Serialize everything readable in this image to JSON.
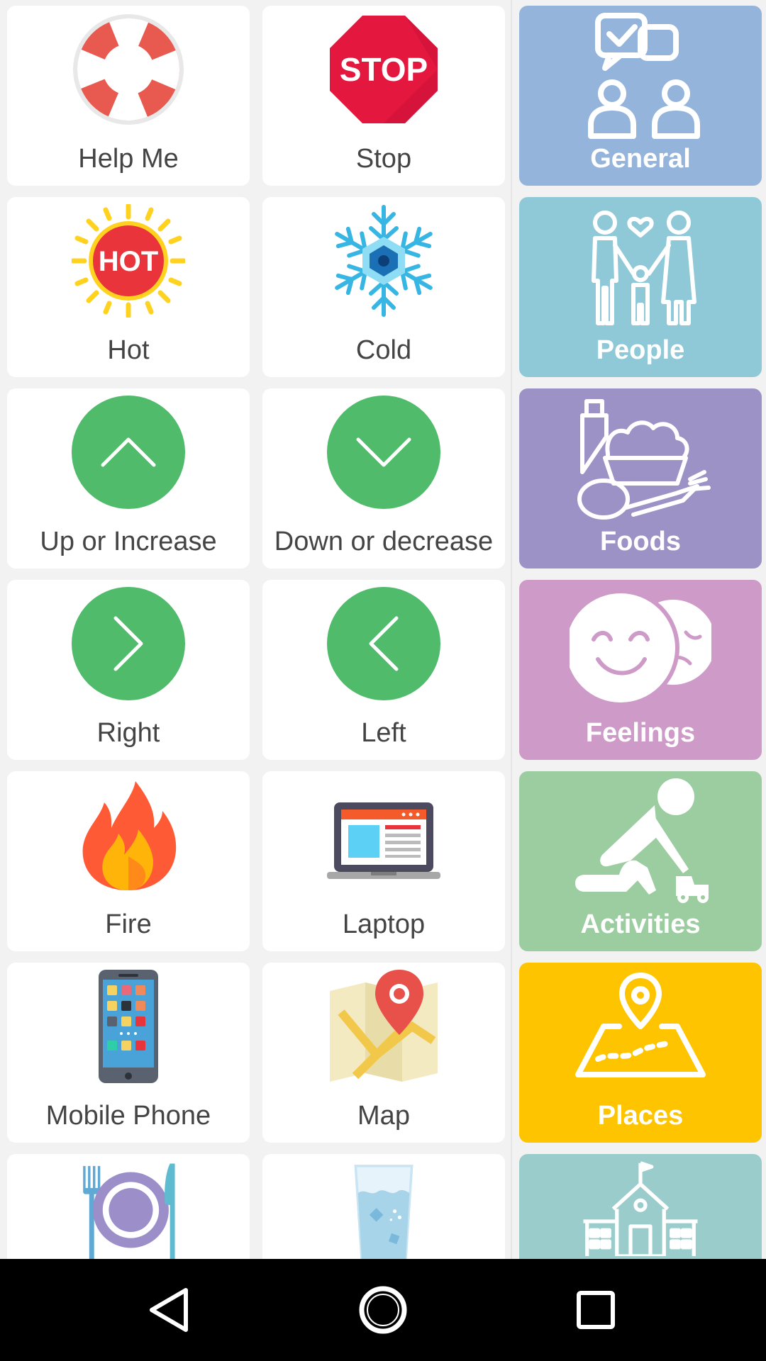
{
  "tiles": [
    {
      "label": "Help Me",
      "icon": "lifebuoy-icon"
    },
    {
      "label": "Stop",
      "icon": "stop-sign-icon"
    },
    {
      "label": "Hot",
      "icon": "hot-sun-icon"
    },
    {
      "label": "Cold",
      "icon": "snowflake-icon"
    },
    {
      "label": "Up or Increase",
      "icon": "chevron-up-icon"
    },
    {
      "label": "Down or decrease",
      "icon": "chevron-down-icon"
    },
    {
      "label": "Right",
      "icon": "chevron-right-icon"
    },
    {
      "label": "Left",
      "icon": "chevron-left-icon"
    },
    {
      "label": "Fire",
      "icon": "fire-icon"
    },
    {
      "label": "Laptop",
      "icon": "laptop-icon"
    },
    {
      "label": "Mobile Phone",
      "icon": "mobile-phone-icon"
    },
    {
      "label": "Map",
      "icon": "map-icon"
    },
    {
      "label": "",
      "icon": "plate-cutlery-icon"
    },
    {
      "label": "",
      "icon": "water-glass-icon"
    }
  ],
  "categories": [
    {
      "label": "General",
      "icon": "conversation-people-icon",
      "color": "#94B4DC"
    },
    {
      "label": "People",
      "icon": "family-icon",
      "color": "#8FC9D8"
    },
    {
      "label": "Foods",
      "icon": "groceries-icon",
      "color": "#9C92C6"
    },
    {
      "label": "Feelings",
      "icon": "faces-icon",
      "color": "#CE9AC8"
    },
    {
      "label": "Activities",
      "icon": "playing-child-icon",
      "color": "#9CCDA0"
    },
    {
      "label": "Places",
      "icon": "map-pin-icon",
      "color": "#FFC400"
    },
    {
      "label": "",
      "icon": "school-icon",
      "color": "#9ACCCC"
    }
  ],
  "navbar": {
    "back": "back-icon",
    "home": "home-icon",
    "recents": "recents-icon"
  }
}
